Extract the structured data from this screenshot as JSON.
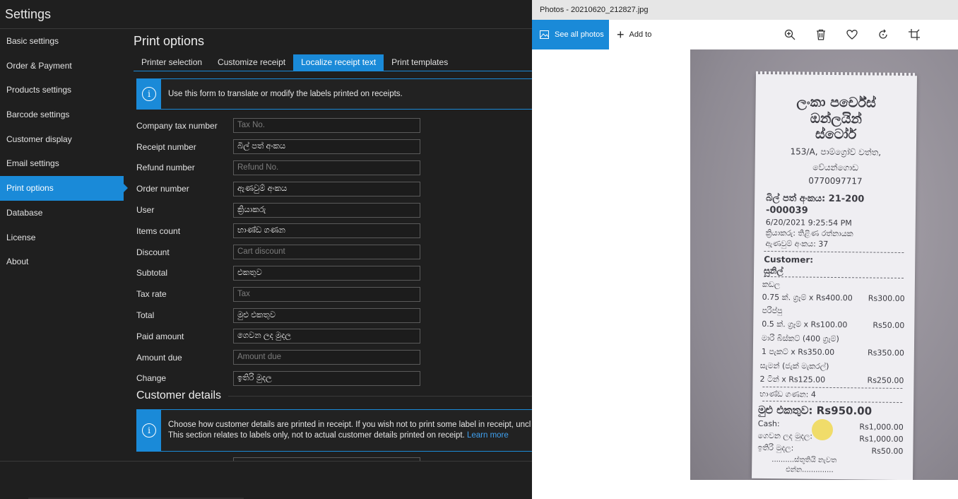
{
  "settings_window": {
    "title": "Settings",
    "nav": [
      {
        "label": "Basic settings"
      },
      {
        "label": "Order & Payment"
      },
      {
        "label": "Products settings"
      },
      {
        "label": "Barcode settings"
      },
      {
        "label": "Customer display"
      },
      {
        "label": "Email settings"
      },
      {
        "label": "Print options",
        "active": true
      },
      {
        "label": "Database"
      },
      {
        "label": "License"
      },
      {
        "label": "About"
      }
    ],
    "section_title": "Print options",
    "tabs": [
      {
        "label": "Printer selection"
      },
      {
        "label": "Customize receipt"
      },
      {
        "label": "Localize receipt text",
        "active": true
      },
      {
        "label": "Print templates"
      }
    ],
    "info_text": "Use this form to translate or modify the labels printed on receipts.",
    "fields": [
      {
        "label": "Company tax number",
        "value": "",
        "placeholder": "Tax No."
      },
      {
        "label": "Receipt number",
        "value": "බිල් පත් අංකය",
        "placeholder": ""
      },
      {
        "label": "Refund number",
        "value": "",
        "placeholder": "Refund No."
      },
      {
        "label": "Order number",
        "value": "ඇණවුම් අංකය",
        "placeholder": ""
      },
      {
        "label": "User",
        "value": "ක්‍රියාකරු",
        "placeholder": ""
      },
      {
        "label": "Items count",
        "value": "භාණ්ඩ ගණන",
        "placeholder": ""
      },
      {
        "label": "Discount",
        "value": "",
        "placeholder": "Cart discount"
      },
      {
        "label": "Subtotal",
        "value": "එකතුව",
        "placeholder": ""
      },
      {
        "label": "Tax rate",
        "value": "",
        "placeholder": "Tax"
      },
      {
        "label": "Total",
        "value": "මුළු එකතුව",
        "placeholder": ""
      },
      {
        "label": "Paid amount",
        "value": "ගෙවන ලද මුදල",
        "placeholder": ""
      },
      {
        "label": "Amount due",
        "value": "",
        "placeholder": "Amount due"
      },
      {
        "label": "Change",
        "value": "ඉතිරි මුදල",
        "placeholder": ""
      }
    ],
    "customer_details_title": "Customer details",
    "customer_info_line1": "Choose how customer details are printed in receipt. If you wish not to print some label in receipt, uncl",
    "customer_info_line2": "This section relates to labels only, not to actual customer details printed on receipt.",
    "learn_more": "Learn more",
    "accent_color": "#1a8ad8"
  },
  "photos_window": {
    "title": "Photos - 20210620_212827.jpg",
    "see_all_label": "See all photos",
    "add_to_label": "Add to",
    "toolbar_icons": [
      "zoom-in-icon",
      "delete-icon",
      "favorite-heart-icon",
      "rotate-icon",
      "crop-icon"
    ],
    "receipt": {
      "store_line1": "ලංකා පර්චේස්",
      "store_line2": "ඔන්ලයින්",
      "store_line3": "ස්ටෝර්",
      "address1": "153/A, පාම්ග්‍රෝව් වත්ත,",
      "address2": "වේයන්ගොඩ",
      "phone": "0770097717",
      "bill_no": "බිල් පත් අංකය: 21-200",
      "bill_no2": "-000039",
      "datetime": "6/20/2021 9:25:54 PM",
      "user": "ක්‍රියාකරු: තිළිණ රත්නායක",
      "order": "ඇණවුම් අංකය: 37",
      "customer_label": "Customer:",
      "customer_name": "සුනිල්",
      "items": [
        {
          "name": "කඩල",
          "qty": "0.75 ක්. ග්‍රෑම් x Rs400.00",
          "amount": "Rs300.00"
        },
        {
          "name": "පරිප්පු",
          "qty": "0.5 ක්. ග්‍රෑම් x Rs100.00",
          "amount": "Rs50.00"
        },
        {
          "name": "මාරි බිස්කට් (400 ග්‍රෑම්)",
          "qty": "1 පැකට් x Rs350.00",
          "amount": "Rs350.00"
        },
        {
          "name": "සැමන් (ජැක් මැකරල්)",
          "qty": "2 ටින් x Rs125.00",
          "amount": "Rs250.00"
        }
      ],
      "items_count": "භාණ්ඩ ගණන: 4",
      "total": "මුළු එකතුව: Rs950.00",
      "cash_label": "Cash:",
      "cash_amount": "Rs1,000.00",
      "paid_label": "ගෙවන ලද මුදල:",
      "paid_amount": "Rs1,000.00",
      "change_label": "ඉතිරි මුදල:",
      "change_amount": "Rs50.00",
      "footer1": "..........ස්තූතියි නැවත",
      "footer2": "එන්න.............."
    }
  }
}
